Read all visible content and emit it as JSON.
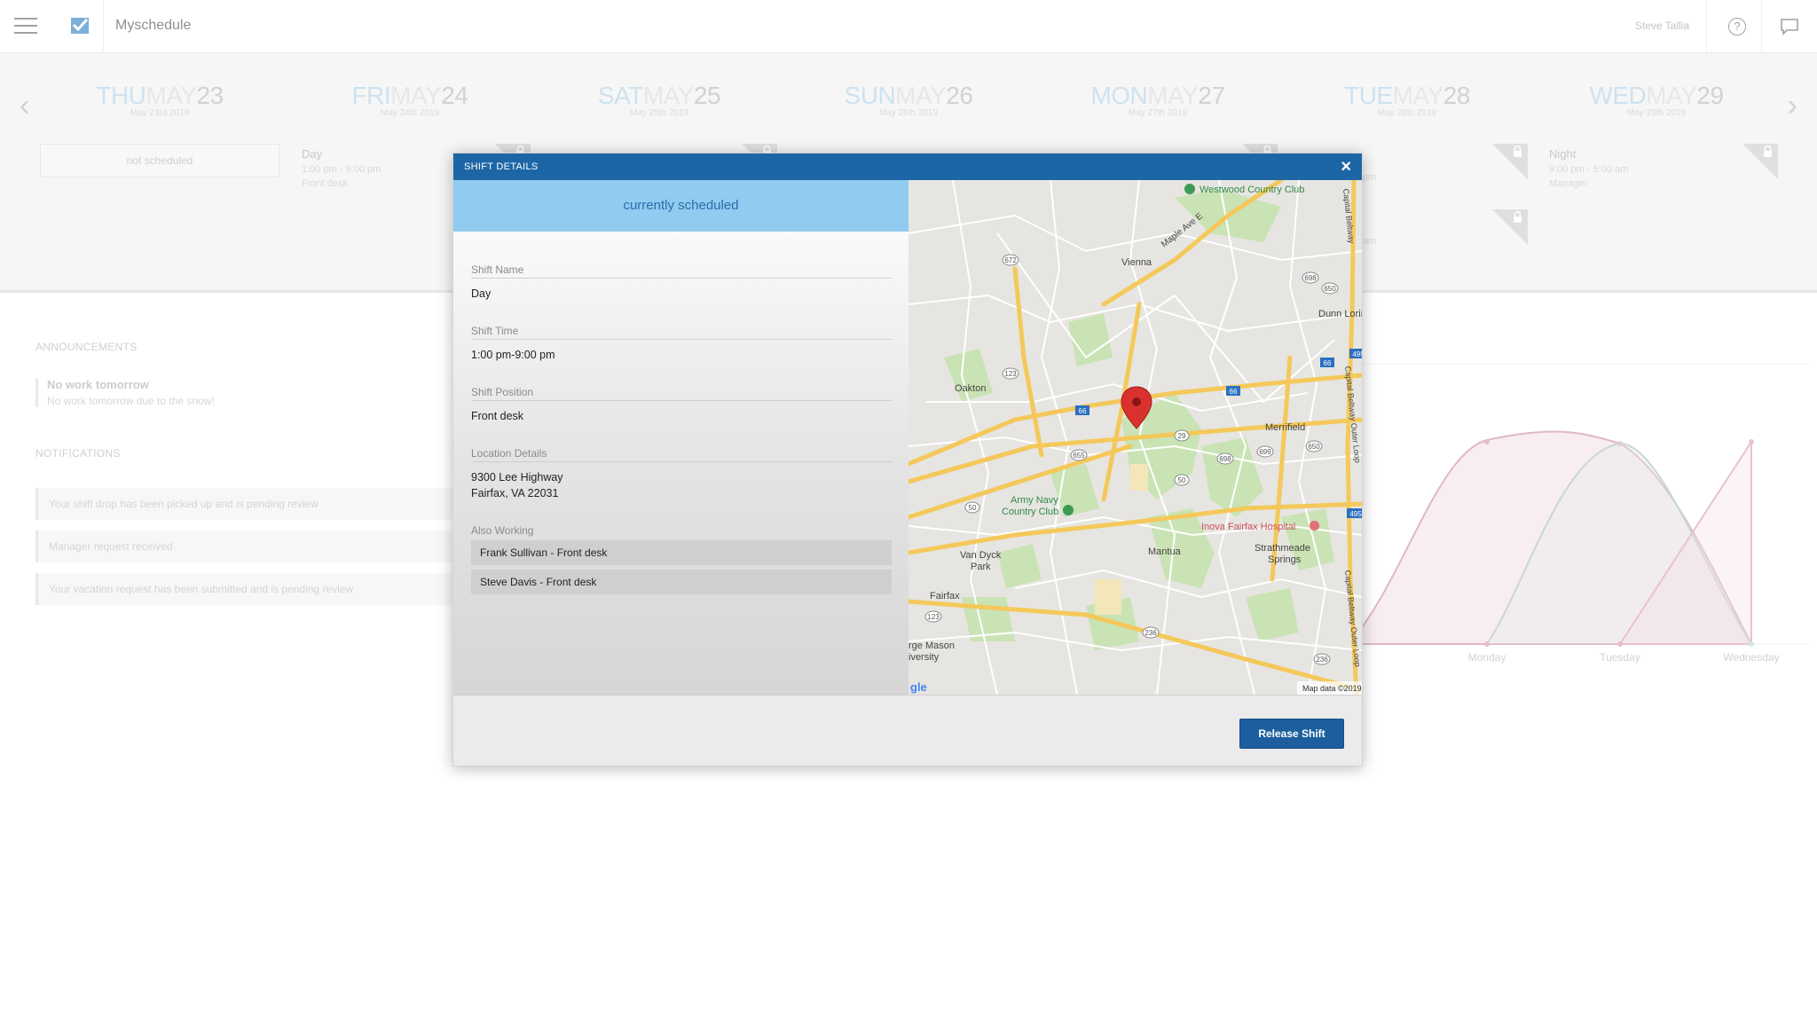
{
  "header": {
    "app_title": "Myschedule",
    "user_name": "Steve Tallia",
    "help_glyph": "?"
  },
  "week": {
    "prev_glyph": "‹",
    "next_glyph": "›",
    "days": [
      {
        "dow": "THU",
        "month": "MAY",
        "num": "23",
        "sub": "May 23rd 2019"
      },
      {
        "dow": "FRI",
        "month": "MAY",
        "num": "24",
        "sub": "May 24th 2019"
      },
      {
        "dow": "SAT",
        "month": "MAY",
        "num": "25",
        "sub": "May 25th 2019"
      },
      {
        "dow": "SUN",
        "month": "MAY",
        "num": "26",
        "sub": "May 26th 2019"
      },
      {
        "dow": "MON",
        "month": "MAY",
        "num": "27",
        "sub": "May 27th 2019"
      },
      {
        "dow": "TUE",
        "month": "MAY",
        "num": "28",
        "sub": "May 28th 2019"
      },
      {
        "dow": "WED",
        "month": "MAY",
        "num": "29",
        "sub": "May 29th 2019"
      }
    ],
    "not_scheduled": "not scheduled",
    "shifts": [
      {
        "name": "Day",
        "time": "1:00 pm - 9:00 pm",
        "position": "Front desk"
      },
      {
        "name": "Night",
        "time": "9:00 pm - 5:00 am",
        "position": "Manager"
      }
    ],
    "partial_tue": "pm",
    "partial_tue2": "am"
  },
  "announcements": {
    "label": "ANNOUNCEMENTS",
    "items": [
      {
        "title": "No work tomorrow",
        "body": "No work tomorrow due to the snow!"
      }
    ]
  },
  "notifications": {
    "label": "NOTIFICATIONS",
    "items": [
      "Your shift drop has been picked up and is pending review",
      "Manager request received",
      "Your vacation request has been submitted and is pending review"
    ]
  },
  "chart_data": {
    "type": "area",
    "categories": [
      "Monday",
      "Tuesday",
      "Wednesday"
    ],
    "partial_left_label": "ay",
    "grid": false
  },
  "modal": {
    "title": "SHIFT DETAILS",
    "close_glyph": "×",
    "status": "currently scheduled",
    "shift_name_label": "Shift Name",
    "shift_name": "Day",
    "shift_time_label": "Shift Time",
    "shift_time": "1:00 pm-9:00 pm",
    "shift_position_label": "Shift Position",
    "shift_position": "Front desk",
    "location_label": "Location Details",
    "location_line1": "9300 Lee Highway",
    "location_line2": "Fairfax, VA 22031",
    "also_working_label": "Also Working",
    "also_working": [
      "Frank Sullivan - Front desk",
      "Steve Davis - Front desk"
    ],
    "release_button": "Release Shift",
    "map": {
      "places": {
        "westwood": "Westwood Country Club",
        "vienna": "Vienna",
        "dunn_loring": "Dunn Lorin",
        "oakton": "Oakton",
        "merrifield": "Merrifield",
        "army_navy": "Army Navy",
        "country_club": "Country Club",
        "inova": "Inova Fairfax Hospital",
        "van_dyck": "Van Dyck",
        "park": "Park",
        "mantua": "Mantua",
        "strathmeade": "Strathmeade",
        "springs": "Springs",
        "fairfax": "Fairfax",
        "george_mason": "rge Mason",
        "university": "iversity",
        "maple_ave": "Maple Ave E",
        "beltway1": "Capital Beltway Outer Loop",
        "beltway2": "Capital Beltway",
        "google": "gle",
        "map_data": "Map data ©2019"
      },
      "shields": [
        "672",
        "698",
        "650",
        "495",
        "66",
        "123",
        "66",
        "66",
        "29",
        "655",
        "699",
        "650",
        "50",
        "123",
        "236",
        "236",
        "495",
        "698",
        "50",
        "123"
      ]
    }
  },
  "colors": {
    "brand_blue": "#1d66a6",
    "status_blue": "#91cbef",
    "chart_pink": "#d9a9b9",
    "chart_green": "#bcd0c4"
  }
}
